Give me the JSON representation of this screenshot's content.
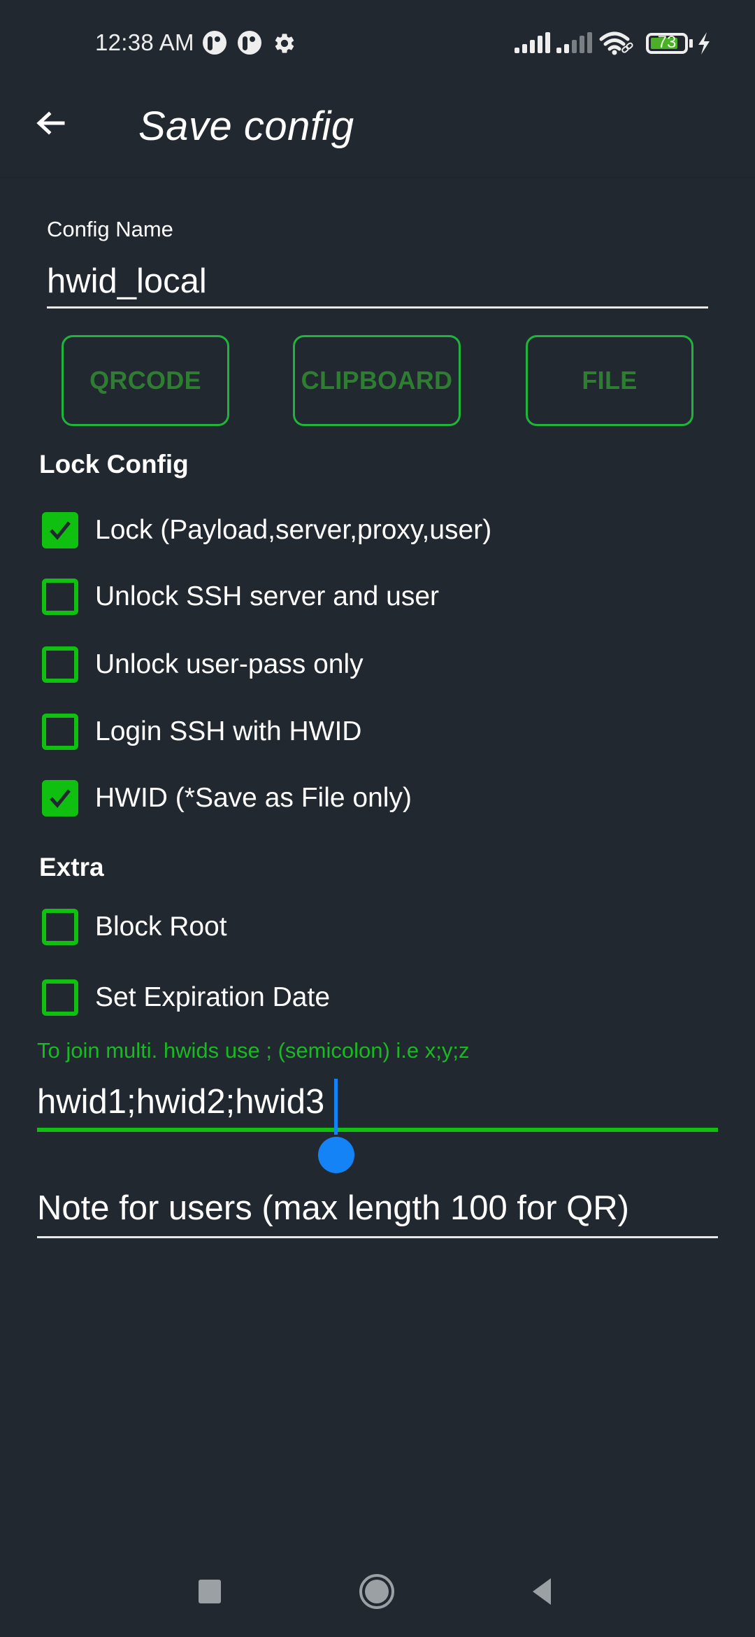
{
  "status_bar": {
    "time": "12:38 AM",
    "notification_icons": [
      "app-notification-icon",
      "app-notification-icon",
      "settings-gear-icon"
    ],
    "signal_icons": [
      "signal-sim1-icon",
      "signal-sim2-icon"
    ],
    "wifi_icon": "wifi-linked-icon",
    "battery_level": "73",
    "battery_percent": 73,
    "charging": true
  },
  "toolbar": {
    "back_icon": "arrow-left-icon",
    "title": "Save config"
  },
  "config_name": {
    "label": "Config Name",
    "value": "hwid_local"
  },
  "export_buttons": [
    {
      "label": "QRCODE"
    },
    {
      "label": "CLIPBOARD"
    },
    {
      "label": "FILE"
    }
  ],
  "lock_section": {
    "title": "Lock Config",
    "options": [
      {
        "label": "Lock (Payload,server,proxy,user)",
        "checked": true
      },
      {
        "label": "Unlock SSH server and user",
        "checked": false
      },
      {
        "label": "Unlock user-pass only",
        "checked": false
      },
      {
        "label": "Login SSH with HWID",
        "checked": false
      },
      {
        "label": "HWID (*Save as File only)",
        "checked": true
      }
    ]
  },
  "extra_section": {
    "title": "Extra",
    "options": [
      {
        "label": "Block Root",
        "checked": false
      },
      {
        "label": "Set Expiration Date",
        "checked": false
      }
    ]
  },
  "hwid_field": {
    "hint": "To join multi. hwids use ; (semicolon) i.e x;y;z",
    "value": "hwid1;hwid2;hwid3"
  },
  "note_field": {
    "placeholder": "Note for users (max length 100 for QR)",
    "value": ""
  },
  "colors": {
    "background": "#21282f",
    "accent_green": "#10c010",
    "button_border": "#21b43c",
    "button_text": "#2e7d32",
    "caret_blue": "#1483f5"
  },
  "nav_bar": {
    "buttons": [
      "recents-square-icon",
      "home-circle-icon",
      "back-triangle-icon"
    ]
  }
}
